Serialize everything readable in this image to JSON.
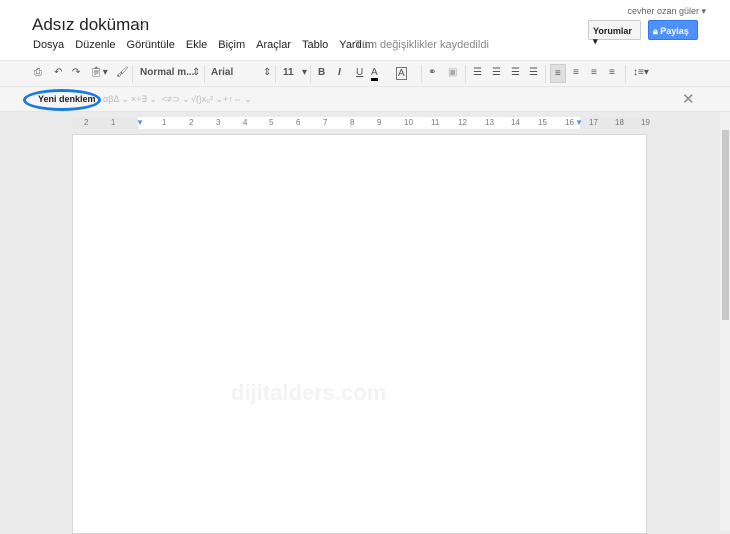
{
  "header": {
    "title": "Adsız doküman",
    "menu": [
      "Dosya",
      "Düzenle",
      "Görüntüle",
      "Ekle",
      "Biçim",
      "Araçlar",
      "Tablo",
      "Yardım"
    ],
    "save_status": "Tüm değişiklikler kaydedildi",
    "user": "cevher ozan güler ▾",
    "comments_label": "Yorumlar ▾",
    "share_label": "Paylaş",
    "share_color": "#4d90fe"
  },
  "toolbar": {
    "style": "Normal m...",
    "font": "Arial",
    "size": "11",
    "bold": "B",
    "italic": "I",
    "underline": "U",
    "text_color": "A",
    "highlight": "A"
  },
  "equation_bar": {
    "new_equation": "Yeni denklem",
    "groups": [
      "αβΔ ⌄",
      "×÷∃ ⌄",
      "<≠⊃ ⌄",
      "√()x₀² ⌄",
      "+↑⇔ ⌄"
    ],
    "close": "✕",
    "highlight_color": "#1a7ae0"
  },
  "ruler": {
    "labels": [
      "2",
      "1",
      "1",
      "2",
      "3",
      "4",
      "5",
      "6",
      "7",
      "8",
      "9",
      "10",
      "11",
      "12",
      "13",
      "14",
      "15",
      "16",
      "17",
      "18",
      "19"
    ]
  },
  "watermark": "dijitalders.com"
}
